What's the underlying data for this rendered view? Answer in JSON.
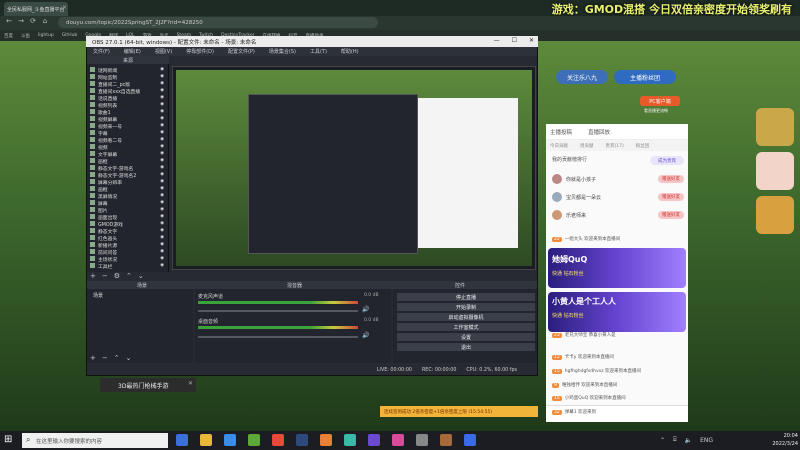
{
  "browser": {
    "tab_title": "全民私服网_斗鱼直播平台",
    "overlay_banner": "游戏：GMOD混搭    今日双倍亲密度开始领奖刷有",
    "url": "douyu.com/topic/2022SpringST_2J2F?rid=428250",
    "bookmarks": [
      "百度",
      "斗鱼",
      "lightup",
      "GitHub",
      "Google",
      "翻译",
      "LOL",
      "游戏",
      "外卖",
      "Steam",
      "Twitch",
      "DestinyTracker",
      "在线转换",
      "抖音",
      "直播助手"
    ]
  },
  "page": {
    "follow_label": "关注乐八九",
    "fan_label": "主播粉丝团",
    "pc_label": "PC客户端",
    "pc_sub": "看直播更流畅",
    "chat_tabs": [
      "主播投稿",
      "直播回放"
    ],
    "chat_subtabs": [
      "今日贡献",
      "周贡献",
      "贵宾(17)",
      "粉丝团"
    ],
    "rank_title": "我的贡献榜排行",
    "rank_button": "成为贵宾",
    "rank_rows": [
      {
        "name": "你就是小孩子",
        "action": "赠送好友"
      },
      {
        "name": "宝贝都是一朵云",
        "action": "赠送好友"
      },
      {
        "name": "乐老师来",
        "action": "赠送好友"
      }
    ],
    "messages": [
      {
        "level": "22",
        "text": "一组大头  欢迎来到本直播间"
      },
      {
        "level": "23",
        "text": "老兄大师宝  恭喜小黄人是"
      },
      {
        "level": "12",
        "text": "卡卡y  欢迎来到本直播间"
      },
      {
        "level": "15",
        "text": "hgfhghdgfsdhvxz  欢迎来到本直播间"
      },
      {
        "level": "9",
        "text": "唯独相伴  欢迎来到本直播间"
      },
      {
        "level": "15",
        "text": "小鸡蛋QuQ  欢迎来到本直播间"
      },
      {
        "level": "32",
        "text": "弹幕1  欢迎来到"
      }
    ],
    "badge_cards": [
      {
        "title": "她姆QuQ",
        "sub": "快通  钻石粉丝"
      },
      {
        "title": "小黄人是个工人人",
        "sub": "快通  钻石粉丝"
      }
    ],
    "gift_bar": "连续签到成功  2倍亲密度+1倍亲密度上限  (15:54:55)"
  },
  "obs": {
    "title": "OBS 27.0.1 (64-bit, windows) - 配置文件: 未命名 - 场景: 未命名",
    "menu": [
      "文件(F)",
      "编辑(E)",
      "视图(V)",
      "停靠部件(D)",
      "配置文件(P)",
      "场景集合(S)",
      "工具(T)",
      "帮助(H)"
    ],
    "sources_header": "来源",
    "sources": [
      "谜网新闻",
      "网站监制",
      "直播间二_pc版",
      "直播间xxx自选直播",
      "话说直播",
      "视频列表",
      "歌曲1",
      "视频屏幕",
      "视频来一号",
      "字幕",
      "视频看二号",
      "视频",
      "文字屏幕",
      "画框",
      "静态文字-游戏名",
      "静态文字-游戏名2",
      "屏幕分辨率",
      "画框",
      "黑屏情况",
      "屏幕",
      "图片",
      "画面出现",
      "GMOD游戏",
      "静态文字",
      "红色画头",
      "新播片源",
      "前间问答",
      "主场状况",
      "工具栏"
    ],
    "scene_header": "场景",
    "scenes": [
      "场景"
    ],
    "mixer_header": "混音器",
    "mixer": [
      {
        "name": "麦克风声道",
        "db": "0.0 dB"
      },
      {
        "name": "桌面音频",
        "db": "0.0 dB"
      }
    ],
    "controls_header": "控件",
    "controls": [
      "停止直播",
      "开始录制",
      "启动虚拟摄像机",
      "工作室模式",
      "设置",
      "退出"
    ],
    "status": {
      "live": "LIVE: 00:00:00",
      "rec": "REC: 00:00:00",
      "cpu": "CPU: 0.2%, 60.00 fps"
    }
  },
  "notification": {
    "text": "3D最热门枪械手游"
  },
  "taskbar": {
    "search_placeholder": "在这里输入你要搜索的内容",
    "language": "ENG",
    "time": "20:04",
    "date": "2022/3/24"
  },
  "colors": {
    "obs_bg": "#272a33",
    "chat_bg": "#fafafa",
    "follow": "#3d6fb8",
    "accent_orange": "#e85a2a",
    "badge_purple": "#6644d0"
  }
}
